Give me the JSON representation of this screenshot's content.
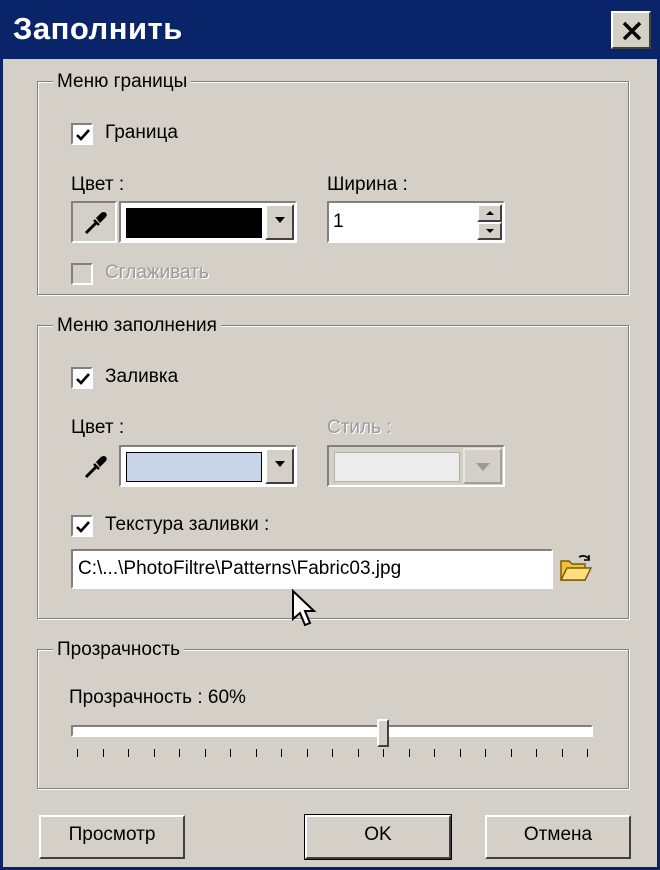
{
  "window": {
    "title": "Заполнить"
  },
  "border_group": {
    "legend": "Меню границы",
    "border_checkbox": {
      "label": "Граница",
      "checked": true
    },
    "color_label": "Цвет :",
    "color_value": "#000000",
    "width_label": "Ширина :",
    "width_value": "1",
    "smooth_checkbox": {
      "label": "Сглаживать",
      "checked": false,
      "enabled": false
    }
  },
  "fill_group": {
    "legend": "Меню заполнения",
    "fill_checkbox": {
      "label": "Заливка",
      "checked": true
    },
    "color_label": "Цвет :",
    "color_value": "#c8d4e8",
    "style_label": "Стиль :",
    "texture_checkbox": {
      "label": "Текстура заливки :",
      "checked": true
    },
    "texture_path": "C:\\...\\PhotoFiltre\\Patterns\\Fabric03.jpg"
  },
  "transparency_group": {
    "legend": "Прозрачность",
    "label": "Прозрачность : 60%",
    "value_percent": 60
  },
  "buttons": {
    "preview": "Просмотр",
    "ok": "OK",
    "cancel": "Отмена"
  },
  "icons": {
    "eyedropper_border": "eyedropper-icon",
    "eyedropper_fill": "eyedropper-icon",
    "open_folder": "folder-open-icon",
    "cursor": "mouse-cursor-icon"
  }
}
